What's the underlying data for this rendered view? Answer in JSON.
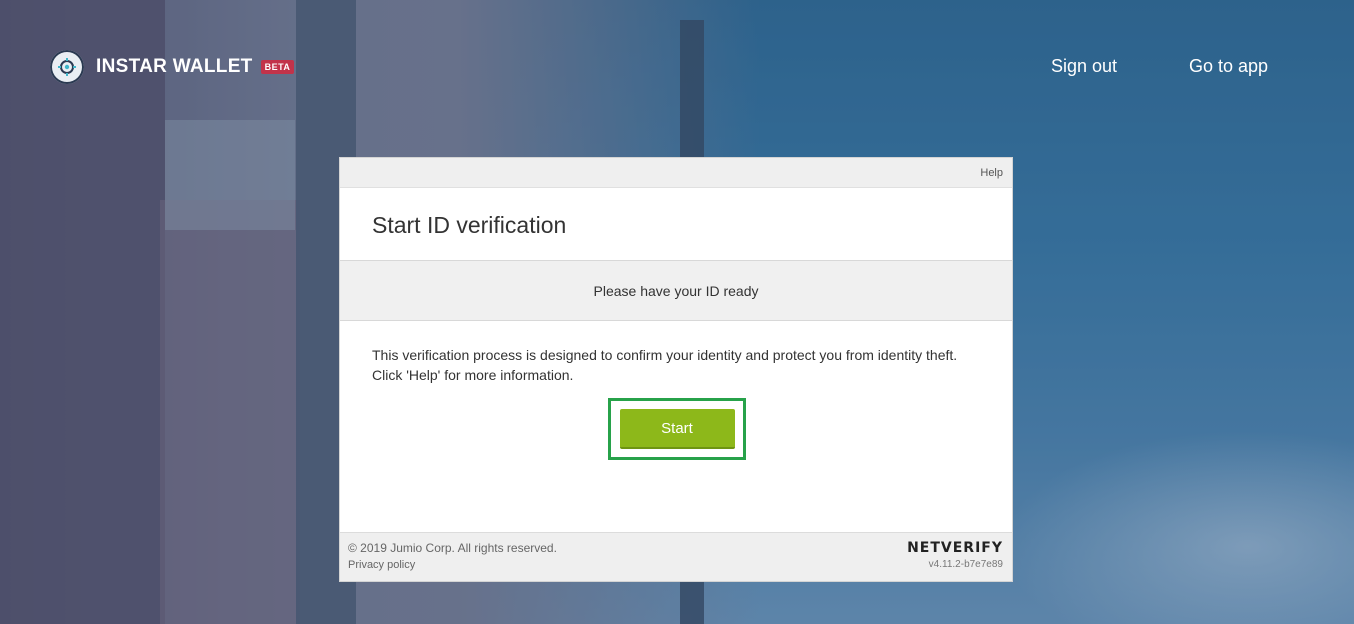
{
  "header": {
    "brand_name": "INSTAR WALLET",
    "badge": "BETA",
    "nav": {
      "sign_out": "Sign out",
      "go_to_app": "Go to app"
    }
  },
  "panel": {
    "help_label": "Help",
    "title": "Start ID verification",
    "notice": "Please have your ID ready",
    "description": "This verification process is designed to confirm your identity and protect you from identity theft. Click 'Help' for more information.",
    "start_label": "Start",
    "footer": {
      "copyright": "© 2019 Jumio Corp. All rights reserved.",
      "privacy_label": "Privacy policy",
      "brand": "NETVERIFY",
      "version": "v4.11.2-b7e7e89"
    }
  },
  "colors": {
    "start_button": "#8db81a",
    "highlight_frame": "#27a24a",
    "beta_badge": "#c2334a"
  }
}
